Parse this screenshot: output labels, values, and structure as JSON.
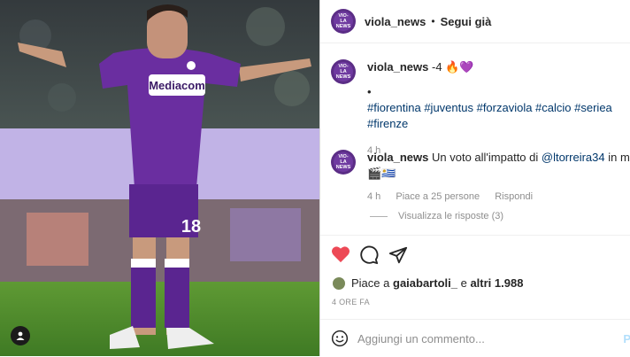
{
  "post": {
    "account_name": "viola_news",
    "avatar_text": [
      "VIO-",
      "LA",
      "NEWS"
    ],
    "follow_label": "Segui già"
  },
  "caption": {
    "username": "viola_news",
    "text": "-4 🔥💜",
    "bullet": "•",
    "hashtags": "#fiorentina #juventus #forzaviola #calcio #seriea #firenze",
    "time": "4 h"
  },
  "comment": {
    "username": "viola_news",
    "text_before": "Un voto all'impatto di ",
    "mention": "@ltorreira34",
    "text_after": " in maglia vio",
    "second_line": "🎬🇺🇾",
    "time": "4 h",
    "likes": "Piace a 25 persone",
    "reply": "Rispondi"
  },
  "replies": {
    "label": "Visualizza le risposte (3)"
  },
  "likes": {
    "prefix": "Piace a ",
    "user": "gaiabartoli_",
    "middle": " e ",
    "others": "altri 1.988"
  },
  "timestamp": "4 ORE FA",
  "composer": {
    "placeholder": "Aggiungi un commento...",
    "publish": "P"
  },
  "photo": {
    "jersey_brand": "Mediacom",
    "jersey_number": "18"
  },
  "icons": [
    "heart-icon-filled",
    "comment-icon",
    "share-icon",
    "emoji-icon",
    "user-tag-icon"
  ],
  "colors": {
    "heart": "#ed4956",
    "link": "#00376b",
    "kit_purple": "#6a2ea0"
  }
}
